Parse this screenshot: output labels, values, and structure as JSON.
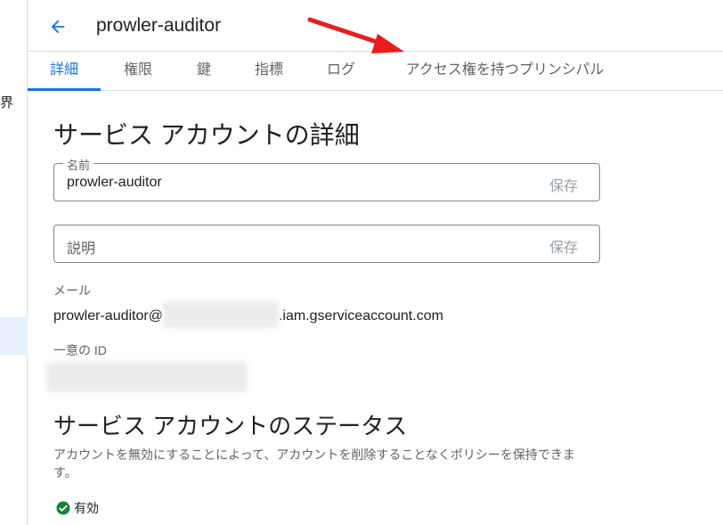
{
  "sidebar": {
    "fragment_text": "界"
  },
  "header": {
    "title": "prowler-auditor"
  },
  "tabs": [
    {
      "label": "詳細",
      "active": true
    },
    {
      "label": "権限",
      "active": false
    },
    {
      "label": "鍵",
      "active": false
    },
    {
      "label": "指標",
      "active": false
    },
    {
      "label": "ログ",
      "active": false
    },
    {
      "label": "アクセス権を持つプリンシパル",
      "active": false
    }
  ],
  "details": {
    "heading": "サービス アカウントの詳細",
    "name_field": {
      "label": "名前",
      "value": "prowler-auditor",
      "save_label": "保存"
    },
    "description_field": {
      "placeholder": "説明",
      "save_label": "保存"
    },
    "email": {
      "label": "メール",
      "prefix": "prowler-auditor@",
      "suffix": ".iam.gserviceaccount.com"
    },
    "unique_id": {
      "label": "一意の ID"
    }
  },
  "status_section": {
    "heading": "サービス アカウントのステータス",
    "description": "アカウントを無効にすることによって、アカウントを削除することなくポリシーを保持できます。",
    "status_label": "有効"
  },
  "colors": {
    "accent": "#1a73e8",
    "arrow": "#ea1c1c",
    "enabled": "#188038"
  }
}
